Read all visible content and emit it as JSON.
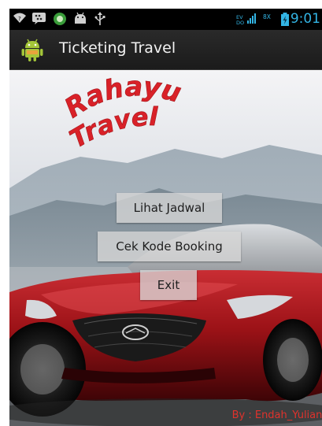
{
  "status_bar": {
    "time": "9:01",
    "left_icons": [
      "wifi-icon",
      "bbm-icon",
      "circle-app-icon",
      "android-icon",
      "usb-icon"
    ],
    "right_icons": [
      "signal-icon",
      "network-icon",
      "battery-icon"
    ]
  },
  "action_bar": {
    "title": "Ticketing Travel",
    "icon": "android-robot-icon"
  },
  "logo": {
    "line1": "Rahayu",
    "line2": "Travel",
    "color": "#d92128"
  },
  "menu": {
    "lihat_jadwal": "Lihat Jadwal",
    "cek_kode_booking": "Cek Kode Booking",
    "exit": "Exit"
  },
  "credit": "By : Endah_Yuliani"
}
